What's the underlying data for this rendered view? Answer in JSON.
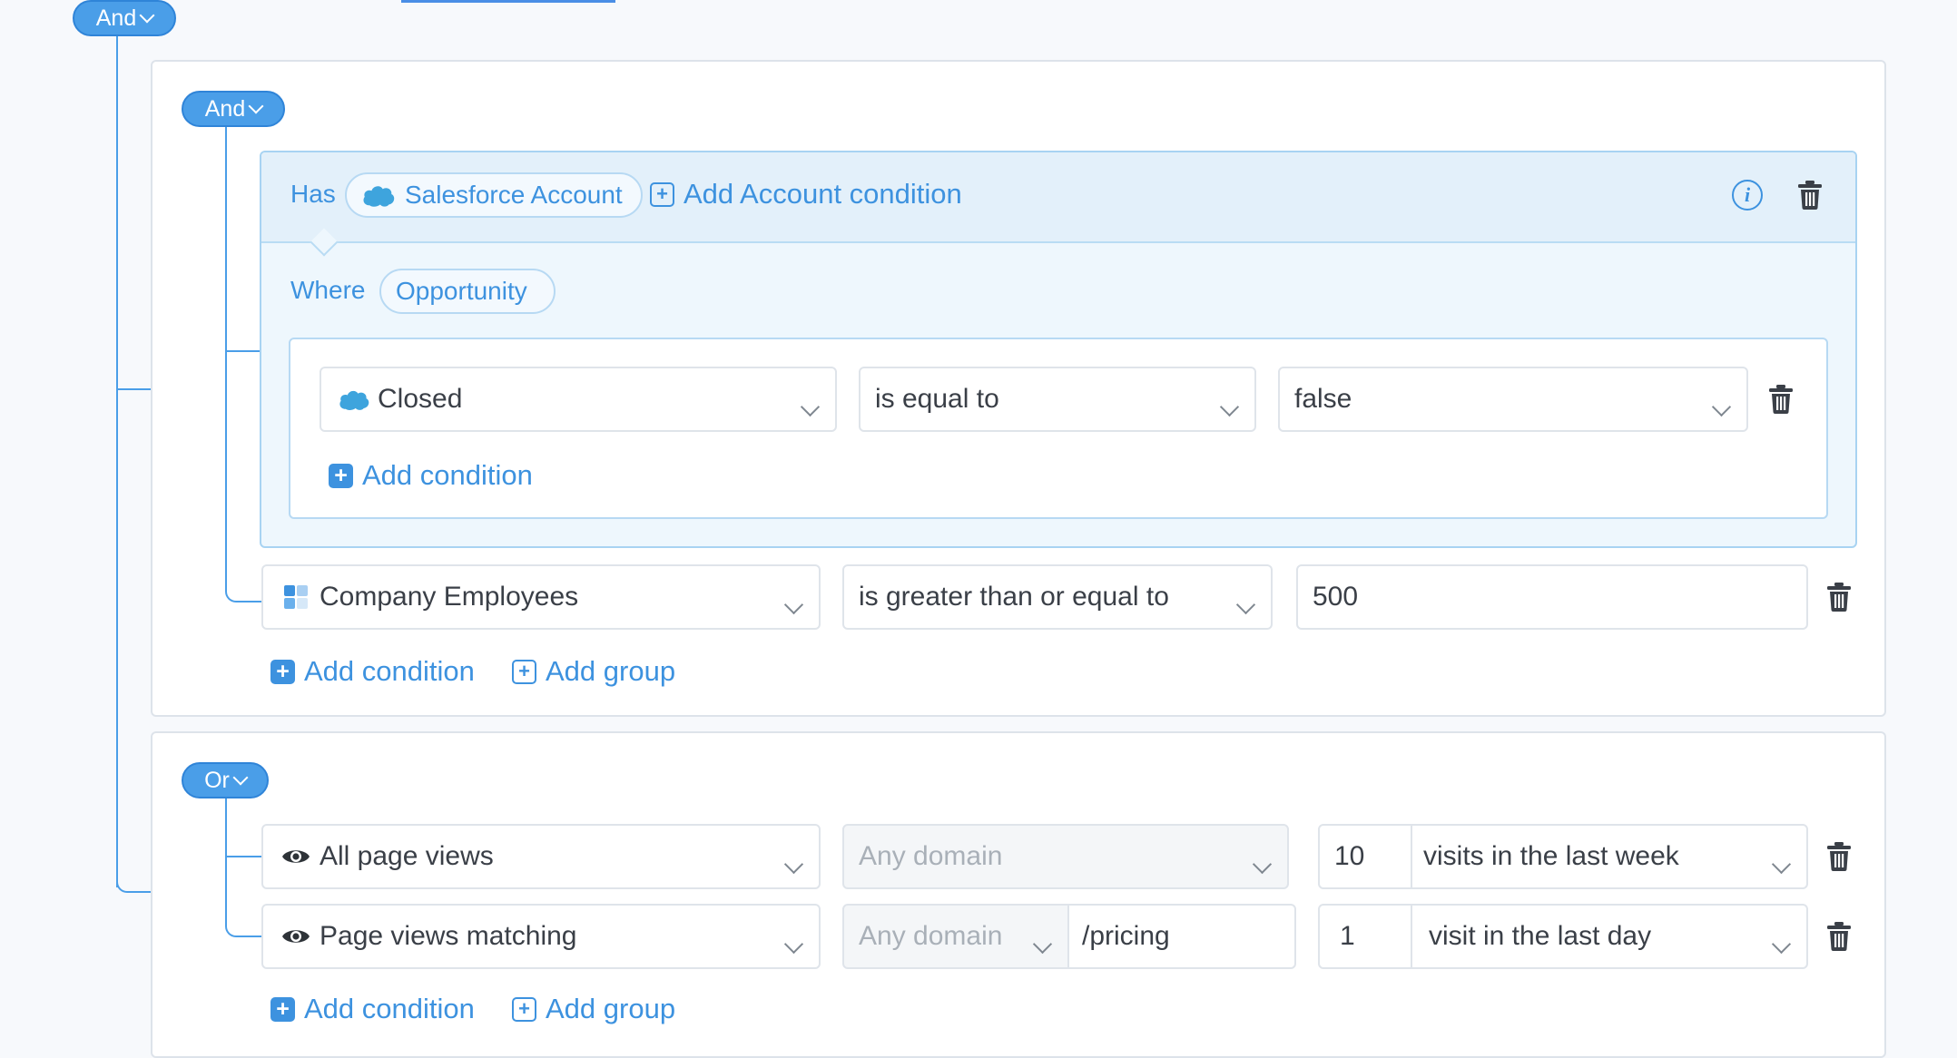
{
  "root_operator": "And",
  "group1": {
    "operator": "And",
    "account": {
      "has_label": "Has",
      "object_label": "Salesforce Account",
      "add_account_condition": "Add Account condition",
      "where_label": "Where",
      "where_object": "Opportunity",
      "condition": {
        "field": "Closed",
        "operator": "is equal to",
        "value": "false"
      },
      "add_condition": "Add condition"
    },
    "condition": {
      "field": "Company Employees",
      "operator": "is greater than or equal to",
      "value": "500"
    },
    "add_condition": "Add condition",
    "add_group": "Add group"
  },
  "group2": {
    "operator": "Or",
    "rows": [
      {
        "field": "All page views",
        "domain": "Any domain",
        "count": "10",
        "period": "visits in the last week"
      },
      {
        "field": "Page views matching",
        "domain": "Any domain",
        "path": "/pricing",
        "count": "1",
        "period": "visit in the last day"
      }
    ],
    "add_condition": "Add condition",
    "add_group": "Add group"
  },
  "colors": {
    "accent": "#4a9ee8",
    "link": "#3d92df",
    "salesforce": "#3ea4dd"
  }
}
